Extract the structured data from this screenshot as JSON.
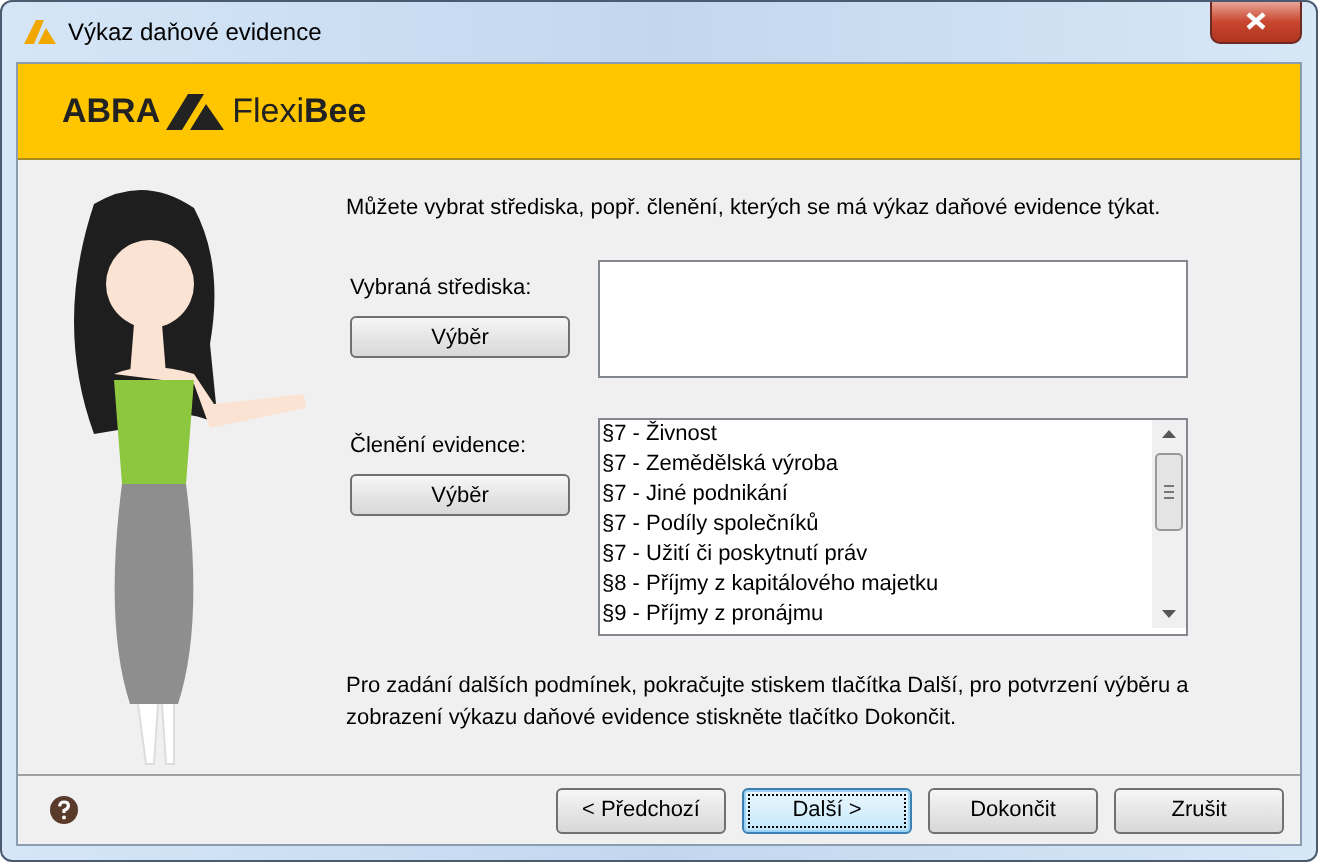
{
  "window": {
    "title": "Výkaz daňové evidence"
  },
  "banner": {
    "brand": "ABRA",
    "product": "Flexi**Bee**"
  },
  "intro": "Můžete vybrat střediska, popř. členění, kterých se má výkaz daňové evidence týkat.",
  "centers": {
    "label": "Vybraná střediska:",
    "button": "Výběr"
  },
  "divisions": {
    "label": "Členění evidence:",
    "button": "Výběr",
    "items": [
      {
        "label": "§7 - Živnost"
      },
      {
        "label": "§7 - Zemědělská výroba"
      },
      {
        "label": "§7 - Jiné podnikání"
      },
      {
        "label": "§7 - Podíly společníků"
      },
      {
        "label": "§7 - Užití či poskytnutí práv"
      },
      {
        "label": "§8 - Příjmy z kapitálového majetku"
      },
      {
        "label": "§9 - Příjmy z pronájmu"
      }
    ]
  },
  "hint": "Pro zadání dalších podmínek, pokračujte stiskem tlačítka Další, pro potvrzení výběru a zobrazení výkazu daňové evidence stiskněte tlačítko Dokončit.",
  "buttons": [
    {
      "label": "< Předchozí",
      "default": false
    },
    {
      "label": "Další >",
      "default": true
    },
    {
      "label": "Dokončit",
      "default": false
    },
    {
      "label": "Zrušit",
      "default": false
    }
  ]
}
